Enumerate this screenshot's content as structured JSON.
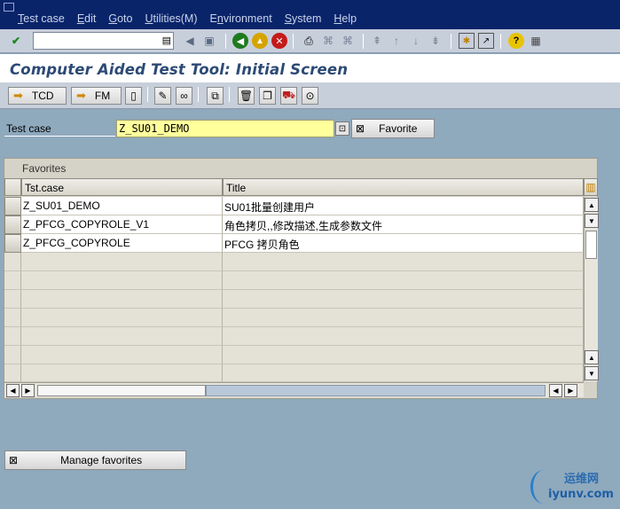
{
  "menubar": {
    "items": [
      {
        "label": "Test case",
        "u": "T"
      },
      {
        "label": "Edit",
        "u": "E"
      },
      {
        "label": "Goto",
        "u": "G"
      },
      {
        "label": "Utilities(M)",
        "u": "U"
      },
      {
        "label": "Environment",
        "u": "n"
      },
      {
        "label": "System",
        "u": "S"
      },
      {
        "label": "Help",
        "u": "H"
      }
    ]
  },
  "stdbar": {
    "command_value": "",
    "icons": [
      "enter-icon",
      "command-history-icon",
      "back-arrow-icon",
      "save-icon",
      "back-icon",
      "exit-icon",
      "cancel-icon",
      "print-icon",
      "find-icon",
      "find-next-icon",
      "first-page-icon",
      "previous-page-icon",
      "next-page-icon",
      "last-page-icon",
      "create-session-icon",
      "shortcut-icon",
      "help-icon",
      "layout-menu-icon"
    ]
  },
  "title": "Computer Aided Test Tool: Initial Screen",
  "appbar": {
    "tcd_label": "TCD",
    "fm_label": "FM"
  },
  "testcase": {
    "label": "Test case",
    "value": "Z_SU01_DEMO"
  },
  "favorite_button": "Favorite",
  "favorites": {
    "title": "Favorites",
    "columns": [
      "Tst.case",
      "Title"
    ],
    "rows": [
      {
        "case": "Z_SU01_DEMO",
        "title": "SU01批量创建用户"
      },
      {
        "case": "Z_PFCG_COPYROLE_V1",
        "title": "角色拷贝,,修改描述,生成参数文件"
      },
      {
        "case": "Z_PFCG_COPYROLE",
        "title": "PFCG 拷贝角色"
      }
    ]
  },
  "manage_favorites": "Manage favorites",
  "watermark": {
    "line1": "运维网",
    "line2": "iyunv.com"
  }
}
